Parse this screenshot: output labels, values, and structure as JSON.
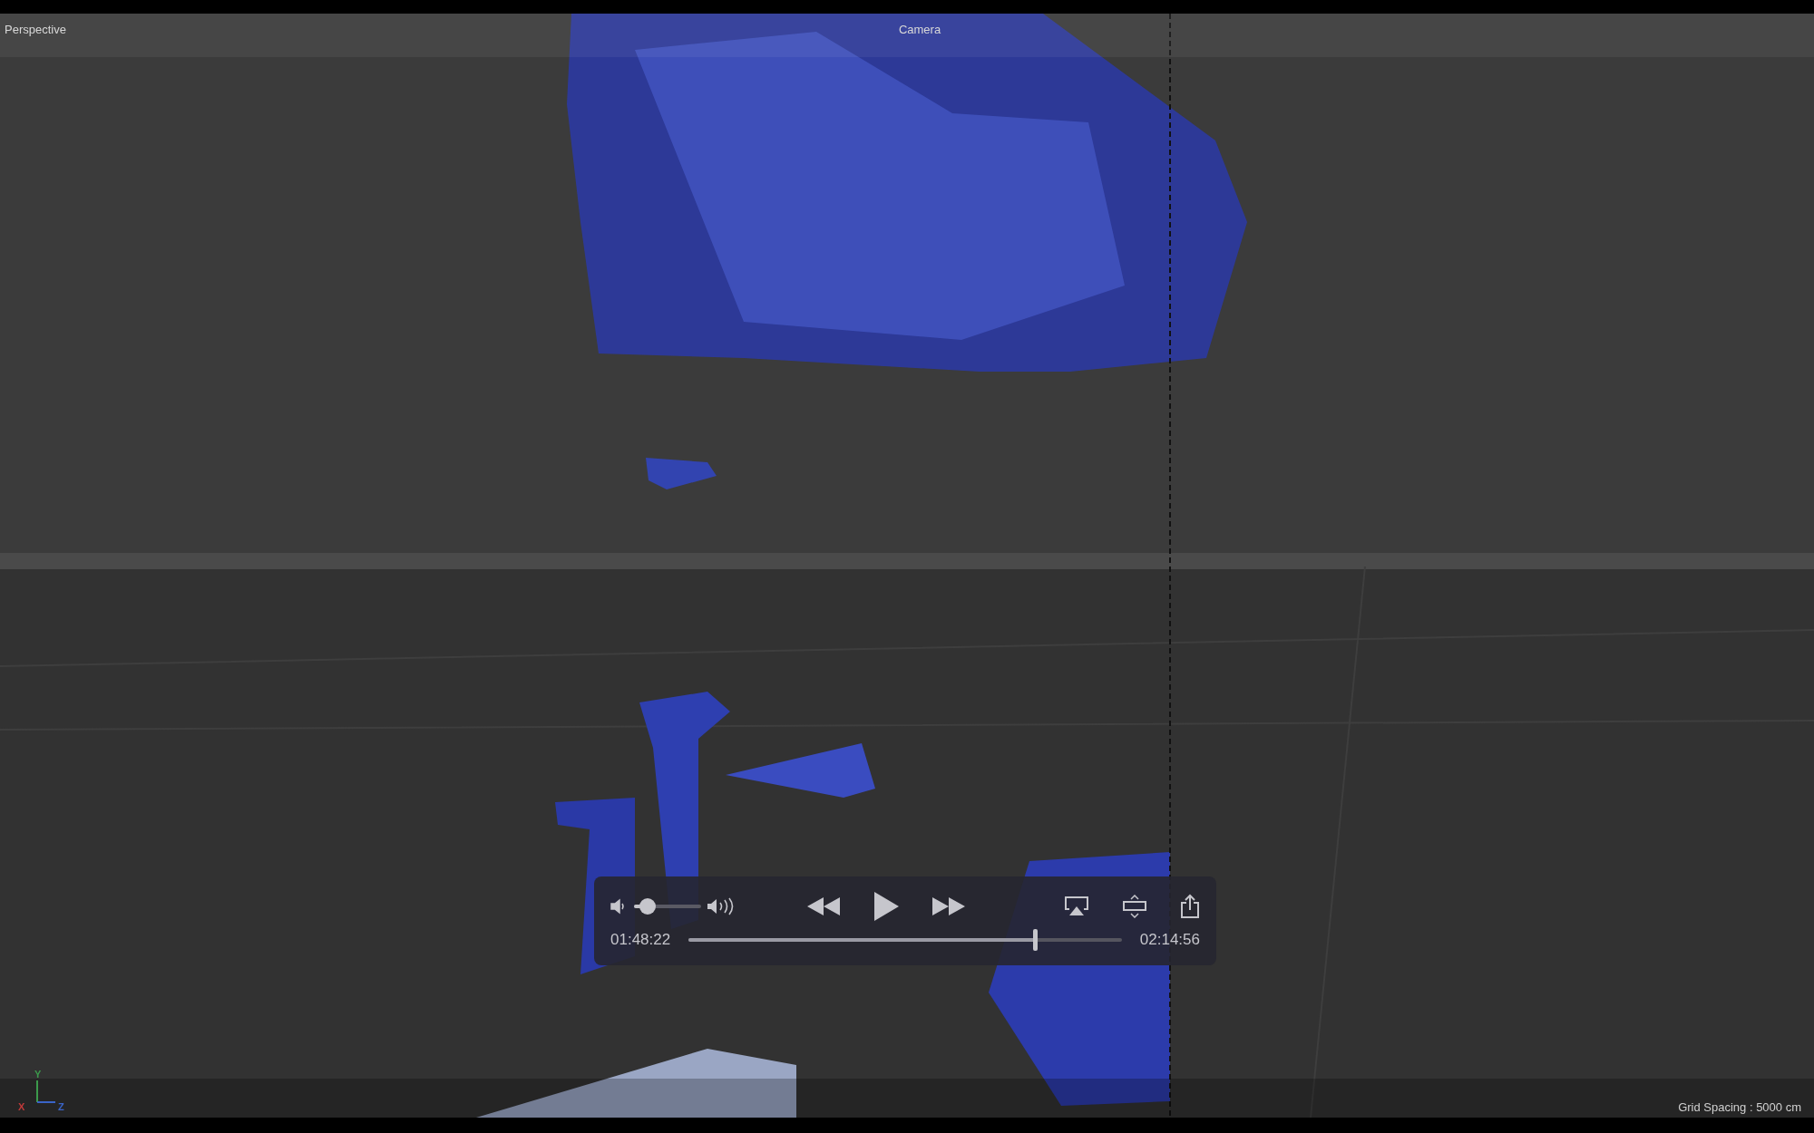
{
  "viewport": {
    "view_name": "Perspective",
    "camera_label": "Camera",
    "axis_labels": [
      "Y",
      "X",
      "Z"
    ],
    "grid_spacing": "Grid Spacing : 5000 cm"
  },
  "player": {
    "volume": {
      "level": 0.2
    },
    "playing": false,
    "elapsed": "01:48:22",
    "progress": {
      "level": 0.8
    },
    "duration": "02:14:56"
  }
}
